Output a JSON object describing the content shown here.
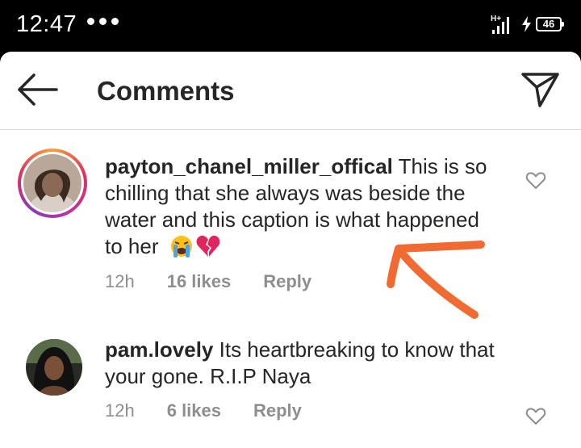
{
  "status_bar": {
    "time": "12:47",
    "network": "H+",
    "battery": "46"
  },
  "header": {
    "title": "Comments",
    "back_icon": "arrow-left-icon",
    "send_icon": "paper-plane-icon"
  },
  "comments": [
    {
      "username": "payton_chanel_miller_offical",
      "text": " This is so chilling that she always was beside the water and this caption is what happened to her",
      "emojis": [
        "loudly-crying-face",
        "broken-heart"
      ],
      "time": "12h",
      "likes": "16 likes",
      "reply": "Reply"
    },
    {
      "username": "pam.lovely",
      "text": " Its heartbreaking to know that your gone. R.I.P Naya",
      "time": "12h",
      "likes": "6 likes",
      "reply": "Reply"
    }
  ],
  "annotation": {
    "type": "hand-drawn-arrow",
    "color": "#f06a32"
  }
}
